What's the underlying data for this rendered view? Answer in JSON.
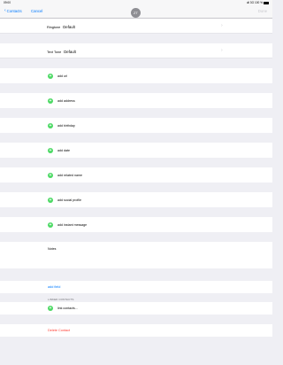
{
  "status": {
    "time": "09:00",
    "indicators": "ull 3G 100 %"
  },
  "nav": {
    "back": "Contacts",
    "cancel": "Cancel",
    "avatar": "ZT",
    "done": "Done"
  },
  "fields": {
    "ringtone": {
      "key": "Ringtone",
      "value": "Default"
    },
    "text_tone": {
      "key": "Text Tone",
      "value": "Default"
    }
  },
  "adds": [
    "add url",
    "add address",
    "add birthday",
    "add date",
    "add related name",
    "add social profile",
    "add instant message"
  ],
  "notes_label": "Notes",
  "add_field": "add field",
  "linked_header": "LINKED CONTACTS",
  "link_contacts": "link contacts...",
  "delete_contact": "Delete Contact",
  "colors": {
    "accent": "#007aff",
    "plus": "#4cd964",
    "destructive": "#ff3b30"
  },
  "icons": {
    "back": "chevron-left-icon",
    "disclosure": "chevron-right-icon",
    "add": "plus-circle-icon"
  }
}
